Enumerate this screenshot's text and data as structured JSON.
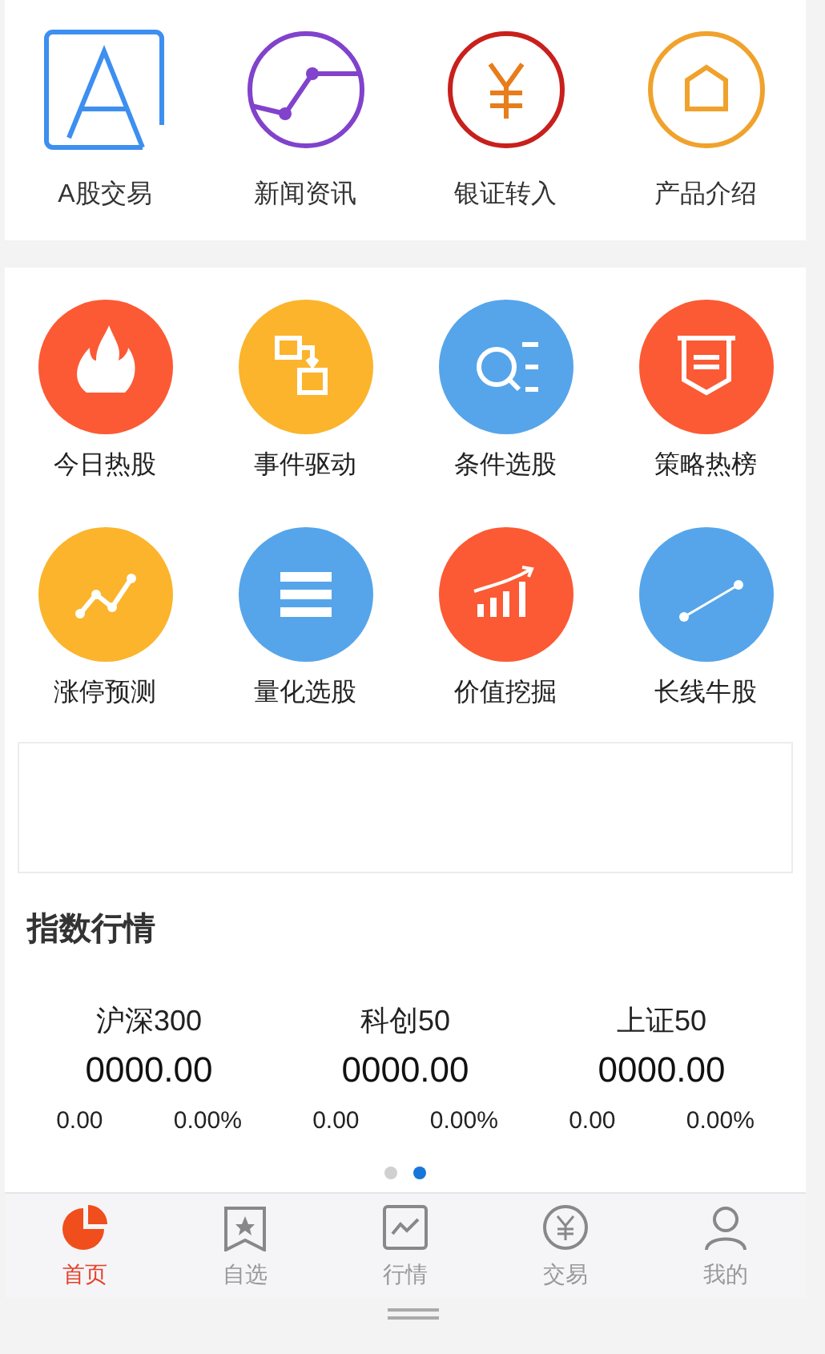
{
  "top_services": [
    {
      "label": "A股交易",
      "color": "#3d8ff0"
    },
    {
      "label": "新闻资讯",
      "color": "#8142cc"
    },
    {
      "label": "银证转入",
      "color": "#c8201c"
    },
    {
      "label": "产品介绍",
      "color": "#f0a22c"
    }
  ],
  "features": [
    {
      "label": "今日热股",
      "color": "#fb5a34"
    },
    {
      "label": "事件驱动",
      "color": "#fbb42c"
    },
    {
      "label": "条件选股",
      "color": "#56a5ea"
    },
    {
      "label": "策略热榜",
      "color": "#fb5a34"
    },
    {
      "label": "涨停预测",
      "color": "#fbb42c"
    },
    {
      "label": "量化选股",
      "color": "#56a5ea"
    },
    {
      "label": "价值挖掘",
      "color": "#fb5a34"
    },
    {
      "label": "长线牛股",
      "color": "#56a5ea"
    }
  ],
  "index_section": {
    "title": "指数行情",
    "indices": [
      {
        "name": "沪深300",
        "value": "0000.00",
        "change": "0.00",
        "percent": "0.00%"
      },
      {
        "name": "科创50",
        "value": "0000.00",
        "change": "0.00",
        "percent": "0.00%"
      },
      {
        "name": "上证50",
        "value": "0000.00",
        "change": "0.00",
        "percent": "0.00%"
      }
    ],
    "pages": [
      {
        "selected": false
      },
      {
        "selected": true
      }
    ]
  },
  "tab_bar": [
    {
      "label": "首页",
      "selected": true
    },
    {
      "label": "自选",
      "selected": false
    },
    {
      "label": "行情",
      "selected": false
    },
    {
      "label": "交易",
      "selected": false
    },
    {
      "label": "我的",
      "selected": false
    }
  ]
}
